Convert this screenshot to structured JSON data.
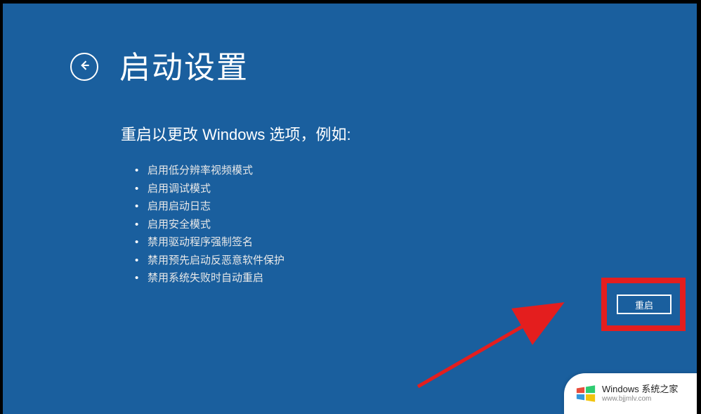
{
  "header": {
    "title": "启动设置"
  },
  "subtitle": "重启以更改 Windows 选项，例如:",
  "options": [
    "启用低分辨率视频模式",
    "启用调试模式",
    "启用启动日志",
    "启用安全模式",
    "禁用驱动程序强制签名",
    "禁用预先启动反恶意软件保护",
    "禁用系统失败时自动重启"
  ],
  "restart": {
    "label": "重启"
  },
  "watermark": {
    "title": "Windows 系统之家",
    "url": "www.bjjmlv.com"
  }
}
